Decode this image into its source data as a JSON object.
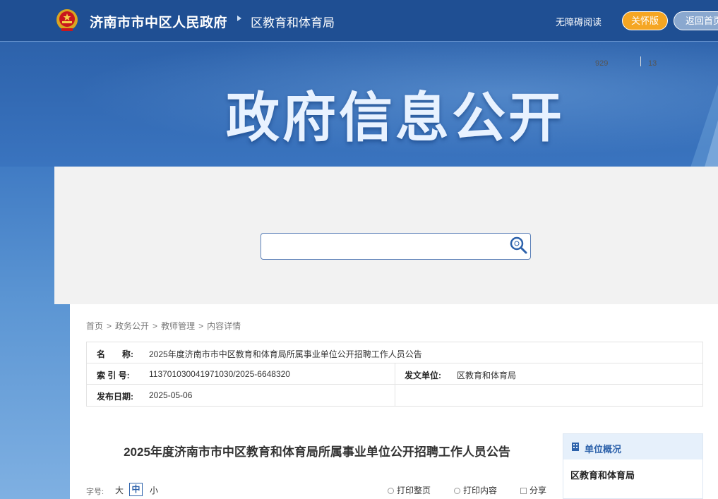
{
  "header": {
    "site_title": "济南市市中区人民政府",
    "dept_title": "区教育和体育局",
    "accessible_label": "无障碍阅读",
    "care_label": "关怀版",
    "home_label": "返回首页"
  },
  "banner": {
    "title": "政府信息公开"
  },
  "search": {
    "placeholder": ""
  },
  "breadcrumb": [
    "首页",
    "政务公开",
    "教师管理",
    "内容详情"
  ],
  "meta": {
    "name_label": "名　　称:",
    "name_value": "2025年度济南市市中区教育和体育局所属事业单位公开招聘工作人员公告",
    "index_label": "索 引 号:",
    "index_value": "113701030041971030/2025-6648320",
    "issuer_label": "发文单位:",
    "issuer_value": "区教育和体育局",
    "date_label": "发布日期:",
    "date_value": "2025-05-06"
  },
  "article": {
    "title": "2025年度济南市市中区教育和体育局所属事业单位公开招聘工作人员公告",
    "font_size_label": "字号:",
    "font_large": "大",
    "font_medium": "中",
    "font_small": "小",
    "print_page": "打印整页",
    "print_content": "打印内容",
    "share": "分享"
  },
  "sidebar": {
    "head": "单位概况",
    "org": "区教育和体育局",
    "stat1": "929",
    "stat2": "13"
  },
  "colors": {
    "header_bg": "#1f4f93",
    "accent_orange": "#f5a623",
    "brand_blue": "#2d62ab"
  }
}
